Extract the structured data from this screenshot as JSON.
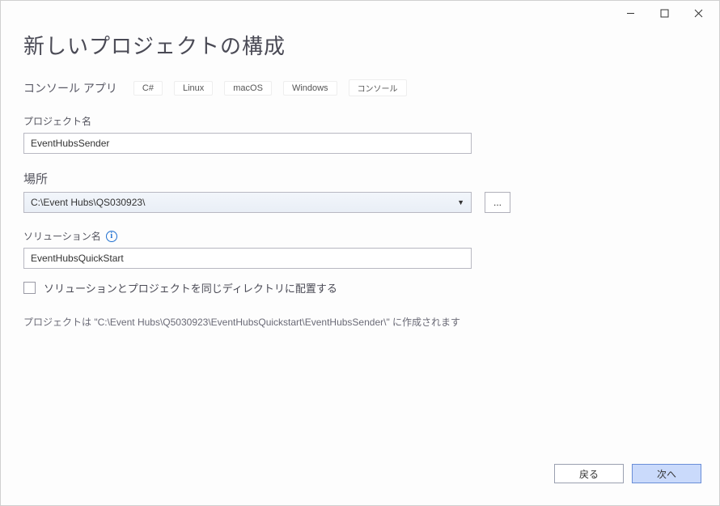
{
  "window": {
    "title": "新しいプロジェクトの構成"
  },
  "template": {
    "name": "コンソール アプリ",
    "tags": [
      "C#",
      "Linux",
      "macOS",
      "Windows",
      "コンソール"
    ]
  },
  "fields": {
    "project_name_label": "プロジェクト名",
    "project_name_value": "EventHubsSender",
    "location_label": "場所",
    "location_value": "C:\\Event Hubs\\QS030923\\",
    "browse_label": "...",
    "solution_name_label": "ソリューション名",
    "solution_name_value": "EventHubsQuickStart",
    "same_dir_checkbox_label": "ソリューションとプロジェクトを同じディレクトリに配置する",
    "same_dir_checked": false
  },
  "path_note": "プロジェクトは \"C:\\Event Hubs\\Q5030923\\EventHubsQuickstart\\EventHubsSender\\\" に作成されます",
  "footer": {
    "back_label": "戻る",
    "next_label": "次へ"
  }
}
